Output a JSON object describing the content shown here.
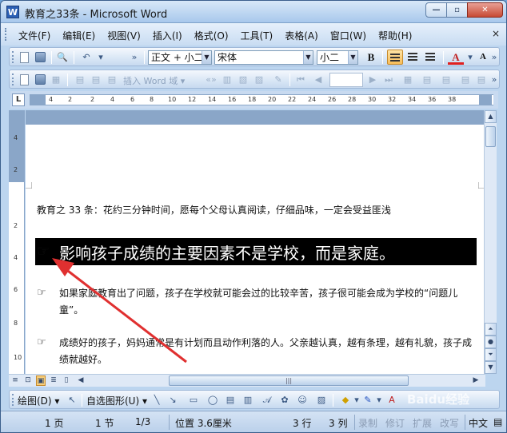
{
  "window": {
    "title": "教育之33条 - Microsoft Word",
    "app_icon": "word-icon"
  },
  "menubar": {
    "items": [
      "文件(F)",
      "编辑(E)",
      "视图(V)",
      "插入(I)",
      "格式(O)",
      "工具(T)",
      "表格(A)",
      "窗口(W)",
      "帮助(H)"
    ],
    "close_glyph": "×"
  },
  "formatting": {
    "style": "正文 + 小二",
    "font": "宋体",
    "size": "小二",
    "bold_label": "B",
    "font_color_label": "A",
    "grow_label": "A"
  },
  "mailmerge": {
    "insert_field_label": "插入 Word 域 ▾"
  },
  "ruler": {
    "ticks": [
      "4",
      "2",
      "2",
      "4",
      "6",
      "8",
      "10",
      "12",
      "14",
      "16",
      "18",
      "20",
      "22",
      "24",
      "26",
      "28",
      "30",
      "32",
      "34",
      "36",
      "38"
    ],
    "corner": "L"
  },
  "document": {
    "intro": "教育之 33 条：花约三分钟时间，愿每个父母认真阅读，仔细品味，一定会受益匪浅",
    "headline": "影响孩子成绩的主要因素不是学校，而是家庭。",
    "bullet_glyph": "☞",
    "paragraphs": [
      "如果家庭教育出了问题，孩子在学校就可能会过的比较辛苦，孩子很可能会成为学校的“问题儿童”。",
      "成绩好的孩子，妈妈通常是有计划而且动作利落的人。父亲越认真，越有条理，越有礼貌，孩子成绩就越好。"
    ]
  },
  "drawing": {
    "draw_label": "绘图(D) ▾",
    "autoshapes_label": "自选图形(U) ▾"
  },
  "status": {
    "page": "1 页",
    "section": "1 节",
    "page_of": "1/3",
    "position": "位置 3.6厘米",
    "line": "3 行",
    "column": "3 列",
    "rec": "录制",
    "trk": "修订",
    "ext": "扩展",
    "ovr": "改写",
    "language": "中文"
  },
  "watermark": "Baidu经验",
  "colors": {
    "title_bar": "#a8c8ec",
    "headline_bg": "#000000",
    "annotation_arrow": "#e03030"
  }
}
